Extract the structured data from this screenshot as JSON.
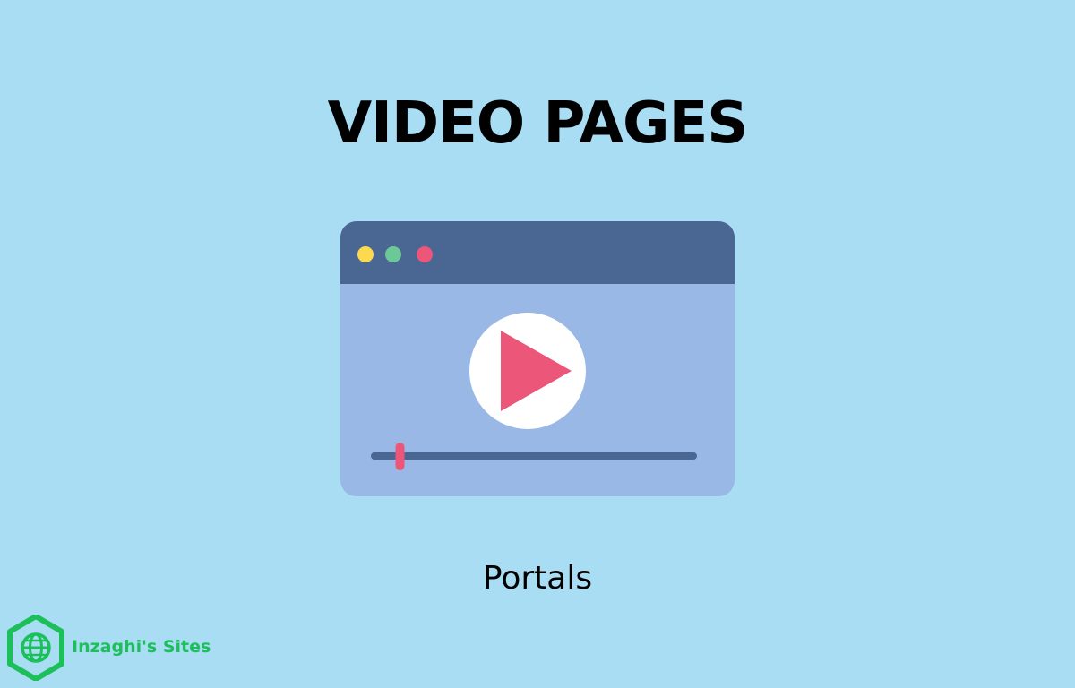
{
  "page": {
    "title": "VIDEO PAGES",
    "subtitle": "Portals"
  },
  "brand": {
    "name": "Inzaghi's Sites",
    "logo_icon": "globe-hexagon-icon"
  },
  "illustration": {
    "icon": "video-player-icon",
    "window_dots": [
      "yellow-dot",
      "green-dot",
      "red-dot"
    ],
    "progress": 0.08
  },
  "colors": {
    "background": "#A8DDF3",
    "title": "#000000",
    "window_titlebar": "#4A6692",
    "window_body": "#9AB8E5",
    "dot_yellow": "#FDD950",
    "dot_green": "#6DC897",
    "dot_red": "#EC5679",
    "play_circle": "#FFFFFF",
    "play_triangle": "#EC5679",
    "progress_track": "#4A6692",
    "progress_handle": "#EC5679",
    "brand": "#1DBF5B"
  }
}
